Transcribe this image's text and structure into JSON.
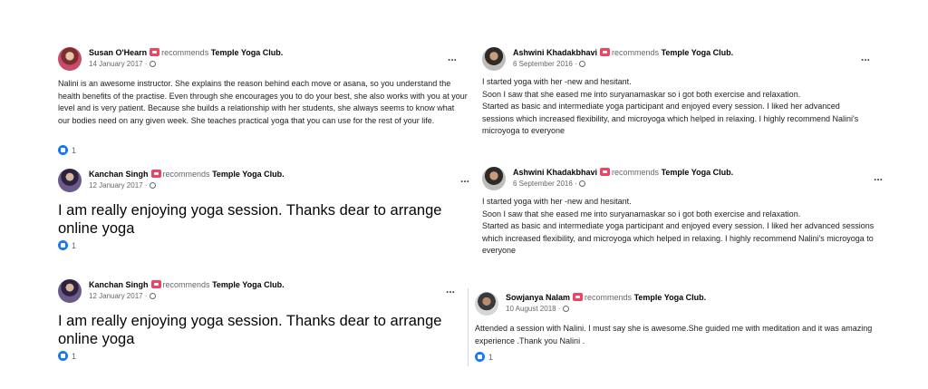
{
  "posts": [
    {
      "author": "Susan O'Hearn",
      "recommends": "recommends",
      "club": "Temple Yoga Club.",
      "date": "14 January 2017",
      "date_sep": "·",
      "menu": "...",
      "text": "Nalini is an awesome instructor.  She explains the reason behind each move or asana, so you understand the health benefits of the practise.  Even through she encourages you to do your best, she also works with you at your level and is very patient. Because she builds a relationship with her students, she always seems to know what our bodies need on any given week.  She teaches practical yoga that you can use for the rest of your life.",
      "reactions": "1"
    },
    {
      "author": "Kanchan Singh",
      "recommends": "recommends",
      "club": "Temple Yoga Club.",
      "date": "12 January 2017",
      "date_sep": "·",
      "menu": "...",
      "text": "I am really enjoying yoga session. Thanks dear to arrange online yoga",
      "reactions": "1"
    },
    {
      "author": "Kanchan Singh",
      "recommends": "recommends",
      "club": "Temple Yoga Club.",
      "date": "12 January 2017",
      "date_sep": "·",
      "menu": "...",
      "text": "I am really enjoying yoga session. Thanks dear to arrange online yoga",
      "reactions": "1"
    },
    {
      "author": "Ashwini Khadakbhavi",
      "recommends": "recommends",
      "club": "Temple Yoga Club.",
      "date": "6 September 2016",
      "date_sep": "·",
      "menu": "...",
      "lines": [
        "I started yoga with her -new and hesitant.",
        "Soon I saw that she eased me into suryanamaskar so i got both exercise and relaxation.",
        "Started as basic and intermediate yoga participant and enjoyed every session. I liked her advanced sessions which increased flexibility, and microyoga which helped in relaxing. I highly recommend Nalini's microyoga to everyone"
      ]
    },
    {
      "author": "Ashwini Khadakbhavi",
      "recommends": "recommends",
      "club": "Temple Yoga Club.",
      "date": "6 September 2016",
      "date_sep": "·",
      "menu": "...",
      "lines": [
        "I started yoga with her -new and hesitant.",
        "Soon I saw that she eased me into suryanamaskar so i got both exercise and relaxation.",
        "Started as basic and intermediate yoga participant and enjoyed every session. I liked her advanced sessions which increased flexibility, and microyoga which helped in relaxing. I highly recommend Nalini's microyoga to everyone"
      ]
    },
    {
      "author": "Sowjanya Nalam",
      "recommends": "recommends",
      "club": "Temple Yoga Club.",
      "date": "10 August 2018",
      "date_sep": "·",
      "text": "Attended a session with Nalini. I must say she is awesome.She guided me with meditation and it was amazing experience .Thank you Nalini .",
      "reactions": "1"
    }
  ]
}
